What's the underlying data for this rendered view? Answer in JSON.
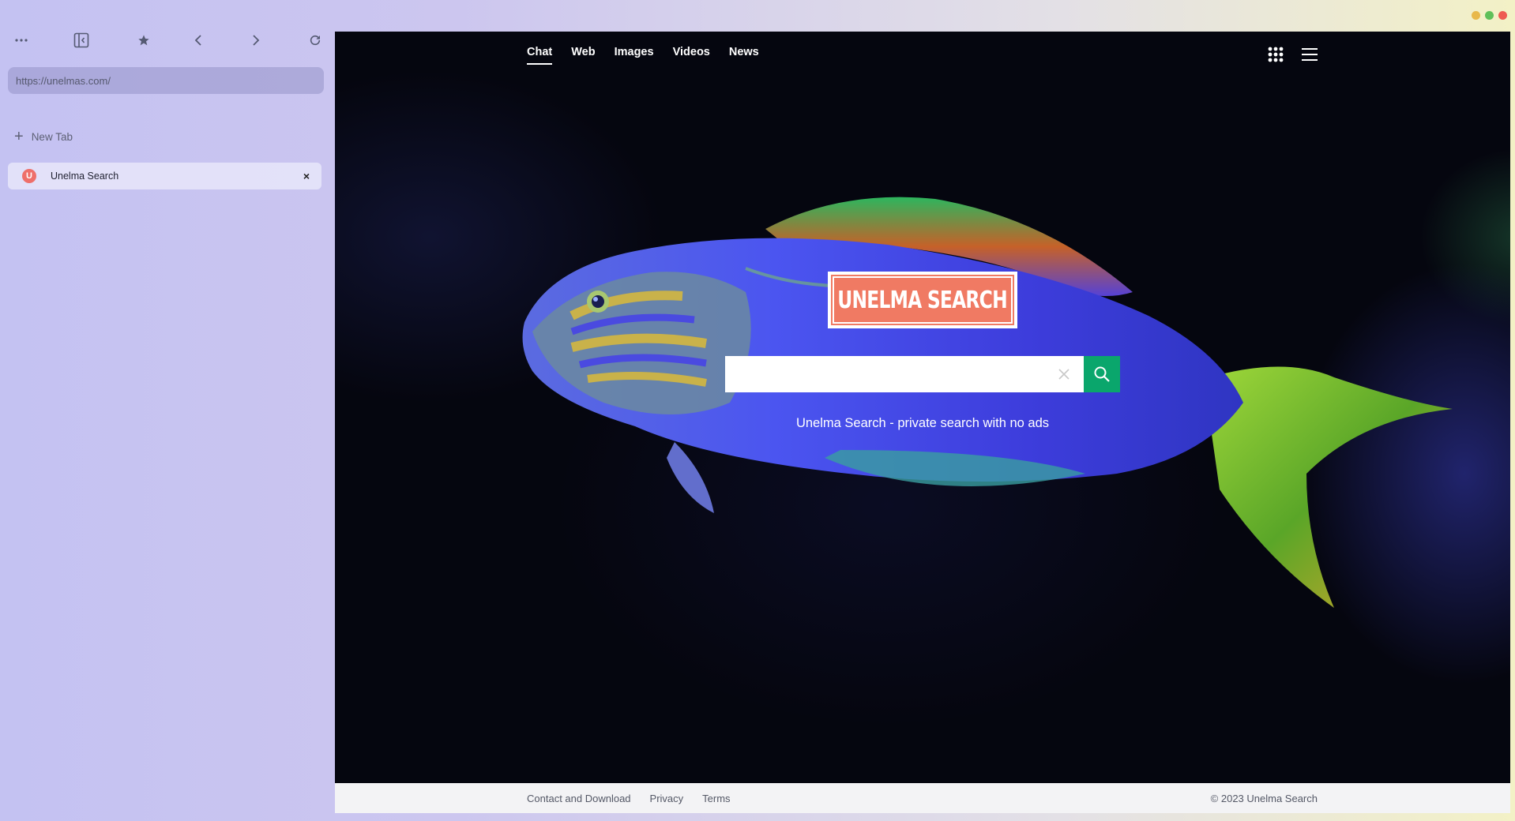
{
  "window": {
    "traffic_colors": {
      "minimize": "#e8b84a",
      "maximize": "#5fc05a",
      "close": "#ee5a52"
    }
  },
  "sidebar": {
    "toolbar": {
      "icons": [
        "more-icon",
        "sidebar-toggle-icon",
        "star-icon",
        "back-icon",
        "forward-icon",
        "reload-icon"
      ]
    },
    "url": "https://unelmas.com/",
    "new_tab_label": "New Tab",
    "tabs": [
      {
        "title": "Unelma Search",
        "favicon_letter": "U",
        "close_label": "×"
      }
    ]
  },
  "page": {
    "nav": [
      {
        "label": "Chat",
        "active": true
      },
      {
        "label": "Web"
      },
      {
        "label": "Images"
      },
      {
        "label": "Videos"
      },
      {
        "label": "News"
      }
    ],
    "logo_text": "UNELMA SEARCH",
    "search": {
      "value": "",
      "placeholder": ""
    },
    "tagline": "Unelma Search - private search with no ads",
    "footer": {
      "links": [
        "Contact and Download",
        "Privacy",
        "Terms"
      ],
      "copyright": "© 2023 Unelma Search"
    },
    "colors": {
      "accent": "#0aa66c",
      "logo": "#f07a63"
    }
  }
}
